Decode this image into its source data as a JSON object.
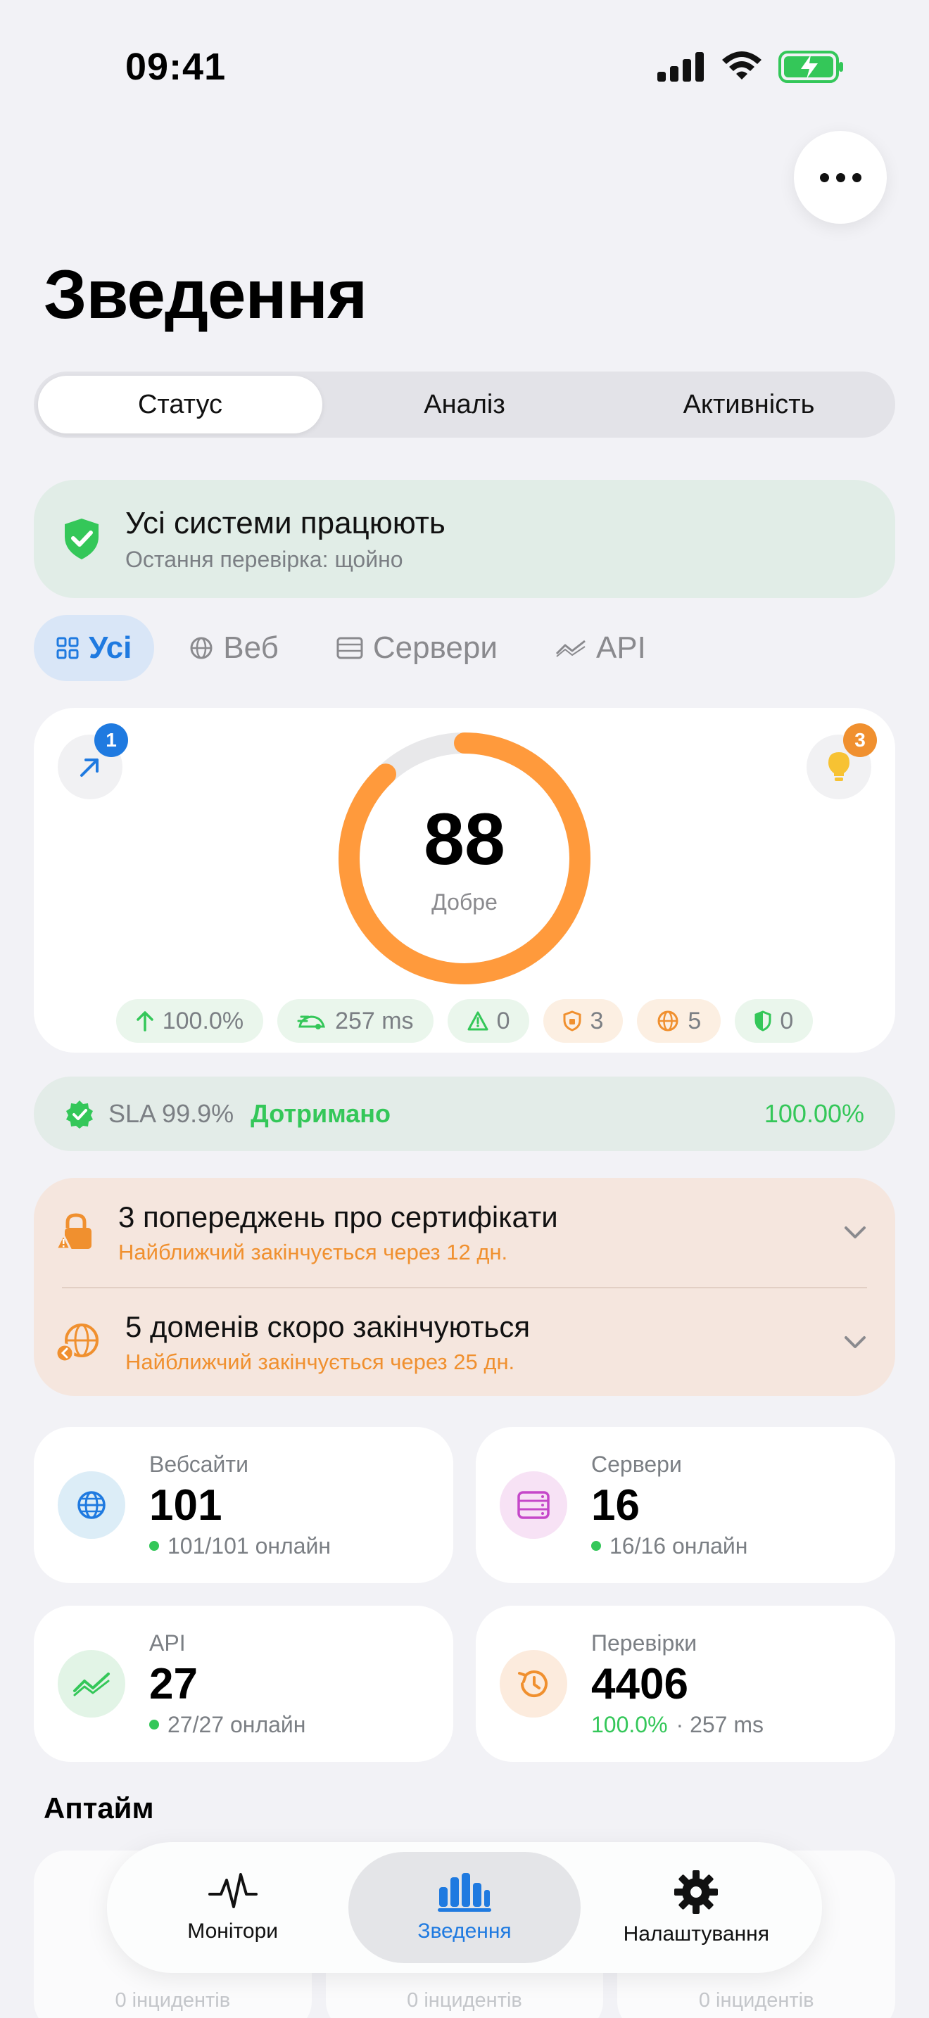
{
  "status_bar": {
    "time": "09:41"
  },
  "page": {
    "title": "Зведення"
  },
  "segments": [
    "Статус",
    "Аналіз",
    "Активність"
  ],
  "system_banner": {
    "title": "Усі системи працюють",
    "subtitle": "Остання перевірка: щойно"
  },
  "filters": [
    "Усі",
    "Веб",
    "Сервери",
    "API"
  ],
  "score": {
    "value": "88",
    "label": "Добре",
    "fraction": 0.88,
    "left_badge": "1",
    "right_badge": "3",
    "metrics": [
      "100.0%",
      "257 ms",
      "0",
      "3",
      "5",
      "0"
    ]
  },
  "sla": {
    "label": "SLA 99.9%",
    "status": "Дотримано",
    "value": "100.00%"
  },
  "warnings": [
    {
      "title": "3 попереджень про сертифікати",
      "subtitle": "Найближчий закінчується через 12 дн."
    },
    {
      "title": "5 доменів скоро закінчуються",
      "subtitle": "Найближчий закінчується через 25 дн."
    }
  ],
  "stats": [
    {
      "label": "Вебсайти",
      "value": "101",
      "sub": "101/101 онлайн"
    },
    {
      "label": "Сервери",
      "value": "16",
      "sub": "16/16 онлайн"
    },
    {
      "label": "API",
      "value": "27",
      "sub": "27/27 онлайн"
    },
    {
      "label": "Перевірки",
      "value": "4406",
      "sub_pct": "100.0%",
      "sub_rest": "· 257 ms"
    }
  ],
  "uptime": {
    "title": "Аптайм",
    "incidents": [
      "0 інцидентів",
      "0 інцидентів",
      "0 інцидентів"
    ]
  },
  "tabs": [
    "Монітори",
    "Зведення",
    "Налаштування"
  ],
  "colors": {
    "accent": "#1f7ae0",
    "success": "#34c759",
    "warning": "#f0902f",
    "gauge": "#ff9a3c"
  }
}
